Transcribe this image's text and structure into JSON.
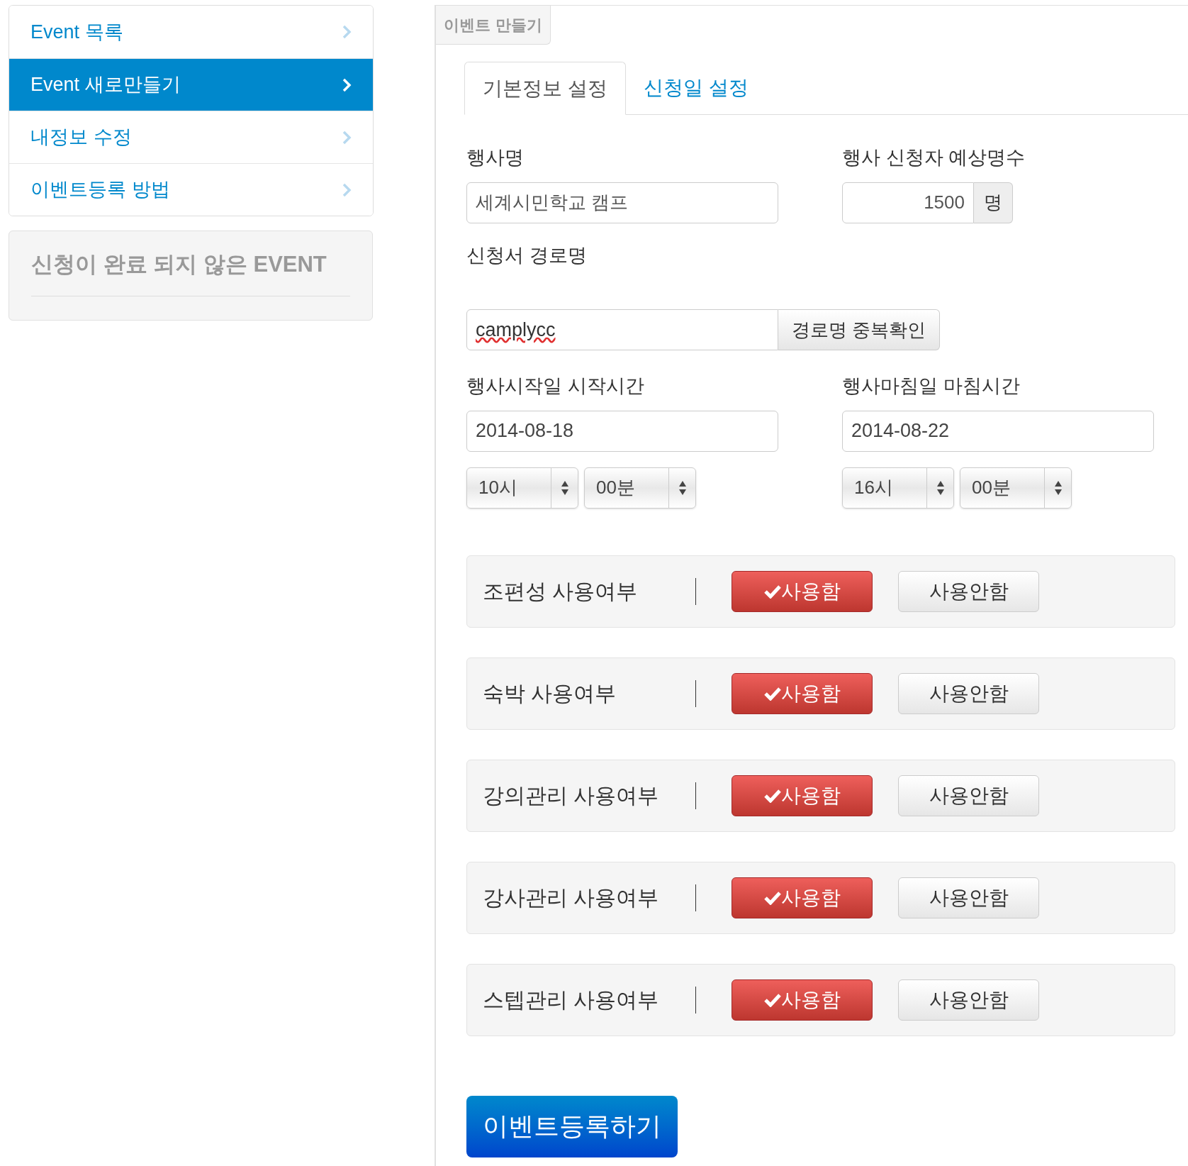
{
  "sidebar": {
    "items": [
      {
        "label": "Event 목록",
        "selected": false
      },
      {
        "label": "Event 새로만들기",
        "selected": true
      },
      {
        "label": "내정보 수정",
        "selected": false
      },
      {
        "label": "이벤트등록 방법",
        "selected": false
      }
    ],
    "pending_panel": {
      "title": "신청이 완료 되지 않은 EVENT"
    }
  },
  "panel": {
    "title": "이벤트 만들기"
  },
  "tabs": [
    {
      "label": "기본정보 설정",
      "selected": true
    },
    {
      "label": "신청일 설정",
      "selected": false
    }
  ],
  "form": {
    "event_name": {
      "label": "행사명",
      "value": "세계시민학교 캠프"
    },
    "expected_count": {
      "label": "행사 신청자 예상명수",
      "value": "1500",
      "unit": "명"
    },
    "path": {
      "label": "신청서 경로명",
      "value": "camplycc",
      "button": "경로명 중복확인"
    },
    "start": {
      "label": "행사시작일 시작시간",
      "date": "2014-08-18",
      "hour": "10시",
      "minute": "00분"
    },
    "end": {
      "label": "행사마침일 마침시간",
      "date": "2014-08-22",
      "hour": "16시",
      "minute": "00분"
    }
  },
  "toggles": [
    {
      "label": "조편성 사용여부",
      "options": [
        {
          "label": "사용함",
          "selected": true
        },
        {
          "label": "사용안함",
          "selected": false
        }
      ]
    },
    {
      "label": "숙박 사용여부",
      "options": [
        {
          "label": "사용함",
          "selected": true
        },
        {
          "label": "사용안함",
          "selected": false
        }
      ]
    },
    {
      "label": "강의관리 사용여부",
      "options": [
        {
          "label": "사용함",
          "selected": true
        },
        {
          "label": "사용안함",
          "selected": false
        }
      ]
    },
    {
      "label": "강사관리 사용여부",
      "options": [
        {
          "label": "사용함",
          "selected": true
        },
        {
          "label": "사용안함",
          "selected": false
        }
      ]
    },
    {
      "label": "스텝관리 사용여부",
      "options": [
        {
          "label": "사용함",
          "selected": true
        },
        {
          "label": "사용안함",
          "selected": false
        }
      ]
    }
  ],
  "submit": "이벤트등록하기"
}
